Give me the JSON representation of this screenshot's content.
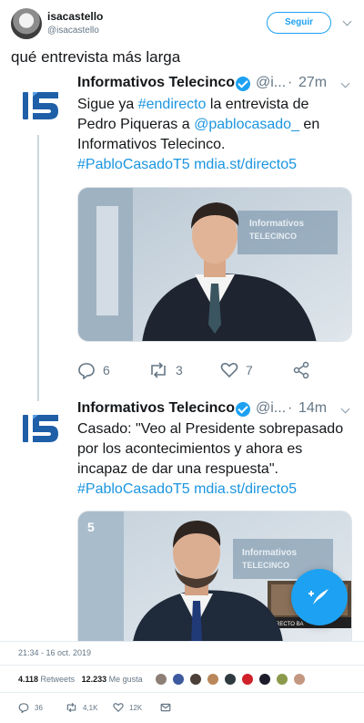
{
  "outer_tweet": {
    "display_name": "isacastello",
    "handle": "@isacastello",
    "follow_label": "Seguir",
    "text": "qué entrevista más larga",
    "timestamp": "21:34 - 16 oct. 2019",
    "retweets_count": "4.118",
    "retweets_label": "Retweets",
    "likes_count": "12.233",
    "likes_label": "Me gusta",
    "reply_count": "36",
    "retweet_count_short": "4,1K",
    "like_count_short": "12K"
  },
  "thread": [
    {
      "author": "Informativos Telecinco",
      "handle": "@i...",
      "dot": "·",
      "time": "27m",
      "text_parts": {
        "p1": "Sigue ya ",
        "hashtag": "#endirecto",
        "p2": " la entrevista de Pedro Piqueras a ",
        "mention": "@pablocasado_",
        "p3": " en Informativos Telecinco.",
        "tag2": "#PabloCasadoT5",
        "url": "mdia.st/directo5"
      },
      "reply_count": "6",
      "retweet_count": "3",
      "like_count": "7",
      "set_text_1": "Informativos",
      "set_text_2": "TELECINCO"
    },
    {
      "author": "Informativos Telecinco",
      "handle": "@i...",
      "dot": "·",
      "time": "14m",
      "text_parts": {
        "p1": "Casado: \"Veo al Presidente sobrepasado por los acontecimientos y ahora es incapaz de dar una respuesta\".",
        "tag": "#PabloCasadoT5",
        "url": "mdia.st/directo5"
      },
      "set_text_1": "Informativos",
      "set_text_2": "TELECINCO",
      "tv_badge": "5",
      "live_badge": "DIRECTO BA"
    }
  ],
  "colors": {
    "accent": "#1da1f2",
    "link": "#1b95e0",
    "muted": "#657786",
    "t5_blue": "#1f5fa8"
  },
  "icons": {
    "reply": "reply-icon",
    "retweet": "retweet-icon",
    "like": "heart-icon",
    "share": "share-icon",
    "dm": "envelope-icon",
    "verified": "verified-badge-icon",
    "compose": "compose-tweet-icon",
    "chevron": "chevron-down-icon"
  }
}
